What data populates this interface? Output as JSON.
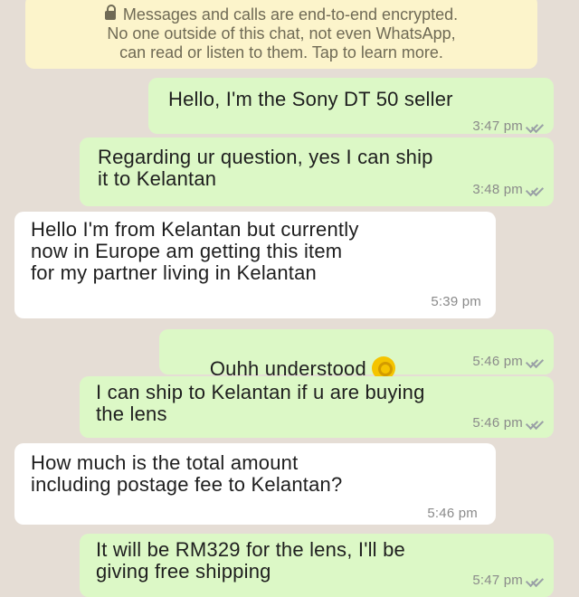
{
  "system_notice": {
    "lines": [
      "Messages and calls are end-to-end encrypted.",
      "No one outside of this chat, not even WhatsApp,",
      "can read or listen to them. Tap to learn more."
    ]
  },
  "messages": [
    {
      "direction": "outgoing",
      "text": "Hello, I'm the Sony DT 50 seller",
      "time": "3:47 pm",
      "status": "read"
    },
    {
      "direction": "outgoing",
      "text": "Regarding ur question, yes I can ship\nit to Kelantan",
      "time": "3:48 pm",
      "status": "read"
    },
    {
      "direction": "incoming",
      "text": "Hello I'm from Kelantan but currently\nnow in Europe am getting this item\nfor my partner living in Kelantan",
      "time": "5:39 pm"
    },
    {
      "direction": "outgoing",
      "text": "Ouhh understood",
      "emoji": "ok-hand-emoji",
      "time": "5:46 pm",
      "status": "read"
    },
    {
      "direction": "outgoing",
      "text": "I can ship to Kelantan if u are buying\nthe lens",
      "time": "5:46 pm",
      "status": "read"
    },
    {
      "direction": "incoming",
      "text": "How much is the total amount\nincluding postage fee to Kelantan?",
      "time": "5:46 pm"
    },
    {
      "direction": "outgoing",
      "text": "It will be RM329 for the lens, I'll be\ngiving free shipping",
      "time": "5:47 pm",
      "status": "read"
    }
  ],
  "colors": {
    "background": "#e5ddd5",
    "outgoing_bubble": "#dcf8c6",
    "incoming_bubble": "#ffffff",
    "system_notice": "#fcf4cb"
  }
}
